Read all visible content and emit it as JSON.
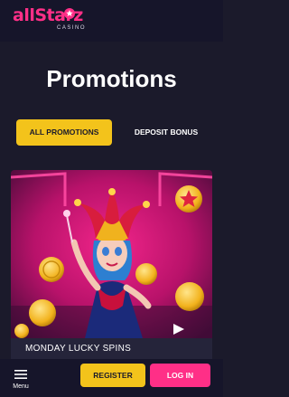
{
  "header": {
    "logo_text": "allStarz",
    "logo_subtext": "CASINO"
  },
  "page": {
    "title": "Promotions"
  },
  "tabs": [
    {
      "label": "ALL PROMOTIONS",
      "active": true
    },
    {
      "label": "DEPOSIT BONUS",
      "active": false
    }
  ],
  "promotions": [
    {
      "title": "MONDAY LUCKY SPINS",
      "image": "jester-character-with-gold-coins"
    }
  ],
  "bottom_bar": {
    "menu_label": "Menu",
    "register_label": "REGISTER",
    "login_label": "LOG IN"
  },
  "colors": {
    "background": "#1b1a2b",
    "brand_pink": "#ff2f87",
    "accent_yellow": "#f3c31b"
  }
}
